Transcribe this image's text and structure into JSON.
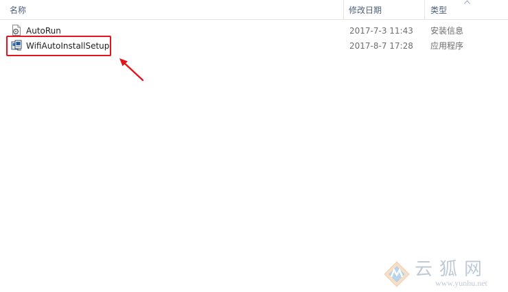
{
  "columns": {
    "name": "名称",
    "modified": "修改日期",
    "type": "类型"
  },
  "files": [
    {
      "name": "AutoRun",
      "modified": "2017-7-3 11:43",
      "type": "安装信息",
      "icon": "settings-file-icon"
    },
    {
      "name": "WifiAutoInstallSetup",
      "modified": "2017-8-7 17:28",
      "type": "应用程序",
      "icon": "setup-exe-icon"
    }
  ],
  "annotation": {
    "color": "#e3141c",
    "highlighted_file": "WifiAutoInstallSetup"
  },
  "watermark": {
    "text": "云狐网",
    "url": "www.yunhu.net"
  }
}
